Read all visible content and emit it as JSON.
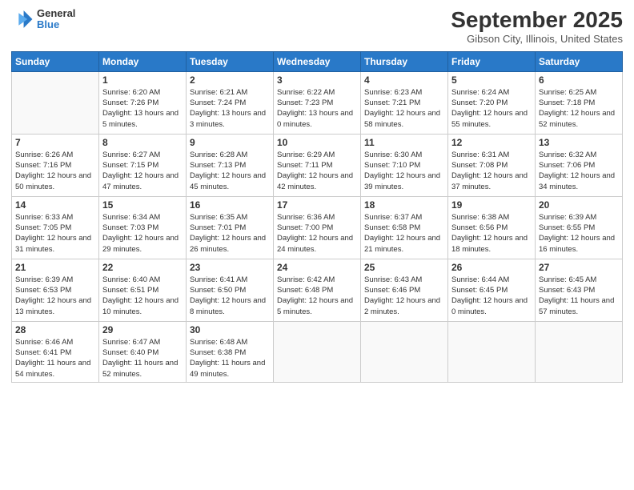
{
  "logo": {
    "general": "General",
    "blue": "Blue"
  },
  "title": "September 2025",
  "subtitle": "Gibson City, Illinois, United States",
  "days": [
    "Sunday",
    "Monday",
    "Tuesday",
    "Wednesday",
    "Thursday",
    "Friday",
    "Saturday"
  ],
  "weeks": [
    [
      {
        "num": "",
        "sunrise": "",
        "sunset": "",
        "daylight": ""
      },
      {
        "num": "1",
        "sunrise": "Sunrise: 6:20 AM",
        "sunset": "Sunset: 7:26 PM",
        "daylight": "Daylight: 13 hours and 5 minutes."
      },
      {
        "num": "2",
        "sunrise": "Sunrise: 6:21 AM",
        "sunset": "Sunset: 7:24 PM",
        "daylight": "Daylight: 13 hours and 3 minutes."
      },
      {
        "num": "3",
        "sunrise": "Sunrise: 6:22 AM",
        "sunset": "Sunset: 7:23 PM",
        "daylight": "Daylight: 13 hours and 0 minutes."
      },
      {
        "num": "4",
        "sunrise": "Sunrise: 6:23 AM",
        "sunset": "Sunset: 7:21 PM",
        "daylight": "Daylight: 12 hours and 58 minutes."
      },
      {
        "num": "5",
        "sunrise": "Sunrise: 6:24 AM",
        "sunset": "Sunset: 7:20 PM",
        "daylight": "Daylight: 12 hours and 55 minutes."
      },
      {
        "num": "6",
        "sunrise": "Sunrise: 6:25 AM",
        "sunset": "Sunset: 7:18 PM",
        "daylight": "Daylight: 12 hours and 52 minutes."
      }
    ],
    [
      {
        "num": "7",
        "sunrise": "Sunrise: 6:26 AM",
        "sunset": "Sunset: 7:16 PM",
        "daylight": "Daylight: 12 hours and 50 minutes."
      },
      {
        "num": "8",
        "sunrise": "Sunrise: 6:27 AM",
        "sunset": "Sunset: 7:15 PM",
        "daylight": "Daylight: 12 hours and 47 minutes."
      },
      {
        "num": "9",
        "sunrise": "Sunrise: 6:28 AM",
        "sunset": "Sunset: 7:13 PM",
        "daylight": "Daylight: 12 hours and 45 minutes."
      },
      {
        "num": "10",
        "sunrise": "Sunrise: 6:29 AM",
        "sunset": "Sunset: 7:11 PM",
        "daylight": "Daylight: 12 hours and 42 minutes."
      },
      {
        "num": "11",
        "sunrise": "Sunrise: 6:30 AM",
        "sunset": "Sunset: 7:10 PM",
        "daylight": "Daylight: 12 hours and 39 minutes."
      },
      {
        "num": "12",
        "sunrise": "Sunrise: 6:31 AM",
        "sunset": "Sunset: 7:08 PM",
        "daylight": "Daylight: 12 hours and 37 minutes."
      },
      {
        "num": "13",
        "sunrise": "Sunrise: 6:32 AM",
        "sunset": "Sunset: 7:06 PM",
        "daylight": "Daylight: 12 hours and 34 minutes."
      }
    ],
    [
      {
        "num": "14",
        "sunrise": "Sunrise: 6:33 AM",
        "sunset": "Sunset: 7:05 PM",
        "daylight": "Daylight: 12 hours and 31 minutes."
      },
      {
        "num": "15",
        "sunrise": "Sunrise: 6:34 AM",
        "sunset": "Sunset: 7:03 PM",
        "daylight": "Daylight: 12 hours and 29 minutes."
      },
      {
        "num": "16",
        "sunrise": "Sunrise: 6:35 AM",
        "sunset": "Sunset: 7:01 PM",
        "daylight": "Daylight: 12 hours and 26 minutes."
      },
      {
        "num": "17",
        "sunrise": "Sunrise: 6:36 AM",
        "sunset": "Sunset: 7:00 PM",
        "daylight": "Daylight: 12 hours and 24 minutes."
      },
      {
        "num": "18",
        "sunrise": "Sunrise: 6:37 AM",
        "sunset": "Sunset: 6:58 PM",
        "daylight": "Daylight: 12 hours and 21 minutes."
      },
      {
        "num": "19",
        "sunrise": "Sunrise: 6:38 AM",
        "sunset": "Sunset: 6:56 PM",
        "daylight": "Daylight: 12 hours and 18 minutes."
      },
      {
        "num": "20",
        "sunrise": "Sunrise: 6:39 AM",
        "sunset": "Sunset: 6:55 PM",
        "daylight": "Daylight: 12 hours and 16 minutes."
      }
    ],
    [
      {
        "num": "21",
        "sunrise": "Sunrise: 6:39 AM",
        "sunset": "Sunset: 6:53 PM",
        "daylight": "Daylight: 12 hours and 13 minutes."
      },
      {
        "num": "22",
        "sunrise": "Sunrise: 6:40 AM",
        "sunset": "Sunset: 6:51 PM",
        "daylight": "Daylight: 12 hours and 10 minutes."
      },
      {
        "num": "23",
        "sunrise": "Sunrise: 6:41 AM",
        "sunset": "Sunset: 6:50 PM",
        "daylight": "Daylight: 12 hours and 8 minutes."
      },
      {
        "num": "24",
        "sunrise": "Sunrise: 6:42 AM",
        "sunset": "Sunset: 6:48 PM",
        "daylight": "Daylight: 12 hours and 5 minutes."
      },
      {
        "num": "25",
        "sunrise": "Sunrise: 6:43 AM",
        "sunset": "Sunset: 6:46 PM",
        "daylight": "Daylight: 12 hours and 2 minutes."
      },
      {
        "num": "26",
        "sunrise": "Sunrise: 6:44 AM",
        "sunset": "Sunset: 6:45 PM",
        "daylight": "Daylight: 12 hours and 0 minutes."
      },
      {
        "num": "27",
        "sunrise": "Sunrise: 6:45 AM",
        "sunset": "Sunset: 6:43 PM",
        "daylight": "Daylight: 11 hours and 57 minutes."
      }
    ],
    [
      {
        "num": "28",
        "sunrise": "Sunrise: 6:46 AM",
        "sunset": "Sunset: 6:41 PM",
        "daylight": "Daylight: 11 hours and 54 minutes."
      },
      {
        "num": "29",
        "sunrise": "Sunrise: 6:47 AM",
        "sunset": "Sunset: 6:40 PM",
        "daylight": "Daylight: 11 hours and 52 minutes."
      },
      {
        "num": "30",
        "sunrise": "Sunrise: 6:48 AM",
        "sunset": "Sunset: 6:38 PM",
        "daylight": "Daylight: 11 hours and 49 minutes."
      },
      {
        "num": "",
        "sunrise": "",
        "sunset": "",
        "daylight": ""
      },
      {
        "num": "",
        "sunrise": "",
        "sunset": "",
        "daylight": ""
      },
      {
        "num": "",
        "sunrise": "",
        "sunset": "",
        "daylight": ""
      },
      {
        "num": "",
        "sunrise": "",
        "sunset": "",
        "daylight": ""
      }
    ]
  ]
}
